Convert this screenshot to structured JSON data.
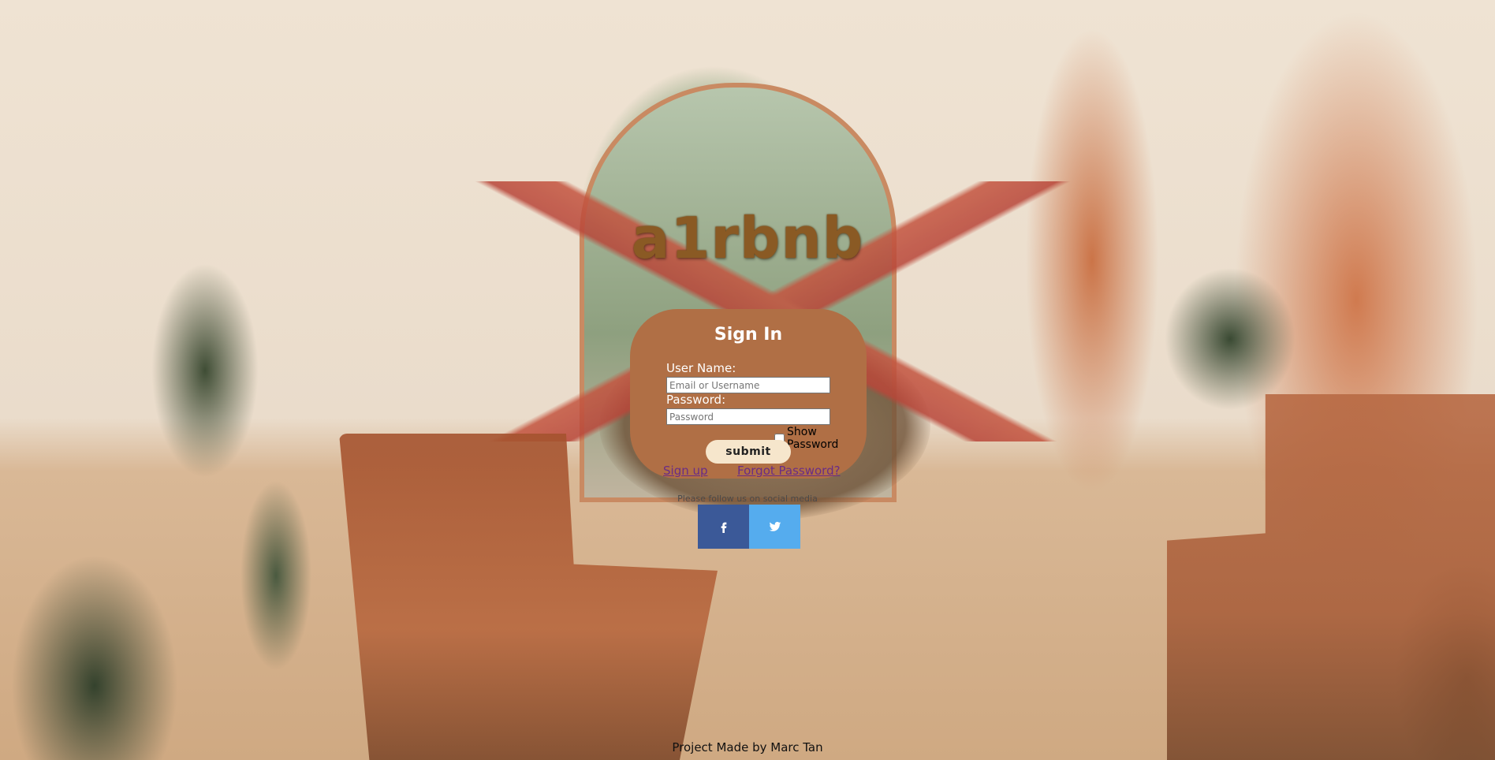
{
  "brand": {
    "logo_text": "a1rbnb"
  },
  "signin": {
    "title": "Sign In",
    "username_label": "User Name:",
    "username_placeholder": "Email or Username",
    "password_label": "Password:",
    "password_placeholder": "Password",
    "show_password_label": "Show Password",
    "submit_label": "submit",
    "signup_link": "Sign up",
    "forgot_link": "Forgot Password?"
  },
  "social": {
    "prompt": "Please follow us on social media",
    "facebook_icon": "facebook-icon",
    "twitter_icon": "twitter-icon",
    "facebook_color": "#3b5998",
    "twitter_color": "#55acee"
  },
  "footer": {
    "credit": "Project Made by Marc Tan"
  },
  "colors": {
    "card_bg": "#b06f45",
    "logo": "#8a5a24",
    "submit_bg": "#f6e6cc",
    "link": "#6a2c86"
  }
}
